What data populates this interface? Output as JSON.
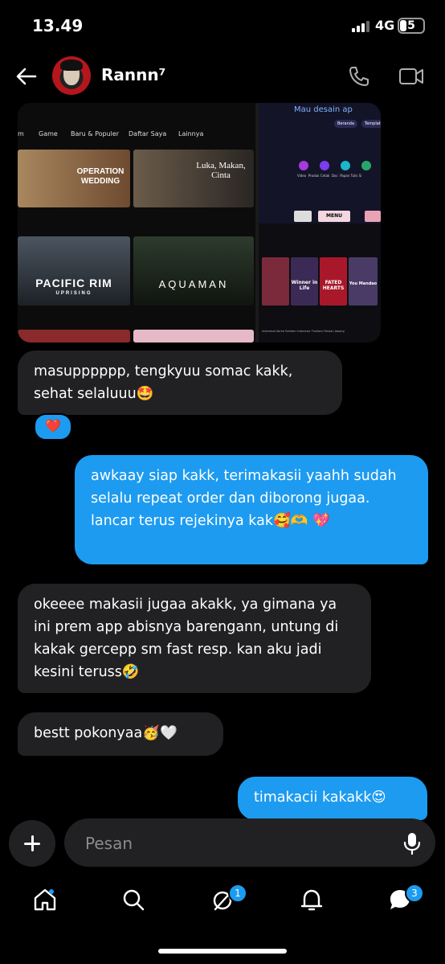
{
  "status_bar": {
    "time": "13.49",
    "network": "4G",
    "battery": "5"
  },
  "header": {
    "contact_name": "Rannn⁷",
    "icons": [
      "back-arrow-icon",
      "avatar",
      "phone-icon",
      "video-camera-icon"
    ]
  },
  "shared_image": {
    "nav_items": [
      "m",
      "Game",
      "Baru & Populer",
      "Daftar Saya",
      "Lainnya"
    ],
    "tiles": [
      "OPERATION WEDDING",
      "Luka, Makan, Cinta",
      "PACIFIC RIM",
      "UPRISING",
      "AQUAMAN"
    ],
    "right_top": {
      "heading": "Mau desain ap",
      "chips": [
        "Beranda",
        "Templat"
      ],
      "apps": [
        "Video",
        "Produk Cetak",
        "Doc",
        "Papan Tulis",
        "Si"
      ],
      "menu_label": "MENU"
    },
    "right_bottom": {
      "posters": [
        "Winner in Life",
        "FATED HEARTS",
        "You Mandao"
      ],
      "tabs": [
        "Indonesia",
        "Korea Selatan",
        "Indonesia",
        "Thailand",
        "Taiwan",
        "Jepang"
      ]
    }
  },
  "messages": [
    {
      "side": "in",
      "text": "masupppppp, tengkyuu somac kakk, sehat selaluuu🤩"
    },
    {
      "side": "out",
      "text": "awkaay siap kakk, terimakasii yaahh sudah selalu repeat order dan diborong jugaa. lancar terus rejekinya kak🥰🫶 💖"
    },
    {
      "side": "in",
      "text": "okeeee makasii jugaa akakk, ya gimana ya ini prem app abisnya barengann, untung di kakak gercepp sm fast resp. kan aku jadi kesini teruss🤣"
    },
    {
      "side": "in",
      "text": "bestt pokonyaa🥳🤍"
    },
    {
      "side": "out",
      "text": "timakacii kakakk😍"
    }
  ],
  "reaction": "❤️",
  "composer": {
    "placeholder": "Pesan"
  },
  "bottom_nav": {
    "items": [
      "home-icon",
      "search-icon",
      "grok-icon",
      "notifications-icon",
      "messages-icon"
    ],
    "grok_badge": "1",
    "messages_badge": "3"
  }
}
